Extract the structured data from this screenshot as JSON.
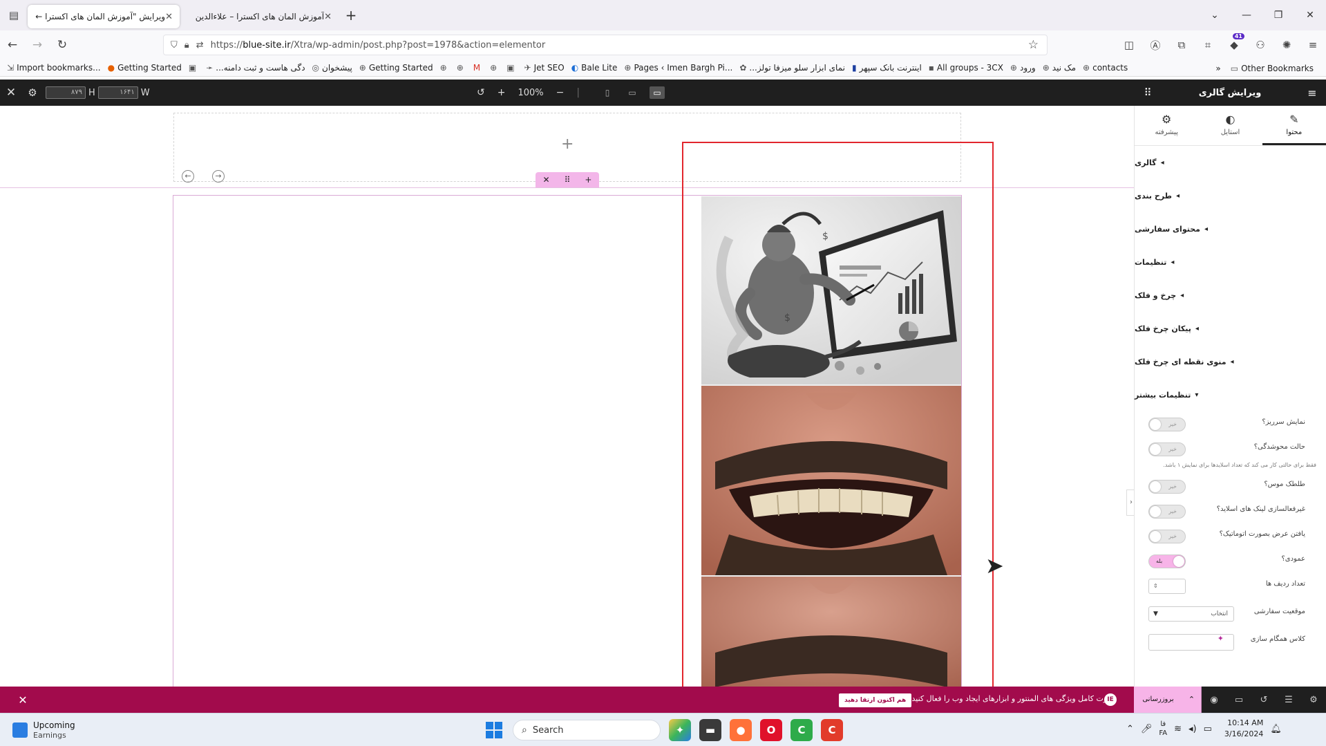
{
  "browser": {
    "tabs": [
      {
        "label": "ویرایش \"آموزش المان های اکسترا ←",
        "active": true
      },
      {
        "label": "آموزش المان های اکسترا – علاءالدین",
        "active": false
      }
    ],
    "url_prefix": "https://",
    "url_domain": "blue-site.ir",
    "url_path": "/Xtra/wp-admin/post.php?post=1978&action=elementor",
    "extension_badge": "41"
  },
  "bookmarks": [
    "Import bookmarks...",
    "Getting Started",
    "...دگی هاست و ثبت دامنه",
    "پیشخوان",
    "Getting Started",
    "Jet SEO",
    "Bale Lite",
    "Pages ‹ Imen Bargh Pi...",
    "...نمای ابزار سلو میزفا تولز",
    "اینترنت بانک سپهر",
    "All groups - 3CX",
    "ورود",
    "مک نید",
    "contacts"
  ],
  "bookmarks_other": "Other Bookmarks",
  "editor": {
    "height_value": "۸۷۹",
    "height_label": "H",
    "width_value": "۱۶۴۱",
    "width_label": "W",
    "zoom": "100%",
    "panel_title": "ویرایش گالری",
    "panel_tabs": [
      {
        "label": "محتوا",
        "icon": "pencil-icon"
      },
      {
        "label": "استایل",
        "icon": "contrast-icon"
      },
      {
        "label": "پیشرفته",
        "icon": "gear-icon"
      }
    ],
    "sections": [
      "گالری",
      "طرح بندی",
      "محتوای سفارشی",
      "تنظیمات",
      "چرخ و فلک",
      "پیکان چرخ فلک",
      "منوی نقطه ای چرخ فلک",
      "تنظیمات بیشتر"
    ],
    "controls": [
      {
        "label": "نمایش سرریز؟",
        "state": "خیر",
        "on": false
      },
      {
        "label": "حالت محوشدگی؟",
        "state": "خیر",
        "on": false
      }
    ],
    "fade_hint": "فقط برای حالتی کار می کند که تعداد اسلایدها برای نمایش ۱ باشد.",
    "controls2": [
      {
        "label": "طلطک موس؟",
        "state": "خیر",
        "on": false
      },
      {
        "label": "غیرفعالسازی لینک های اسلاید؟",
        "state": "خیر",
        "on": false
      },
      {
        "label": "یافتن عرض بصورت اتوماتیک؟",
        "state": "خیر",
        "on": false
      },
      {
        "label": "عمودی؟",
        "state": "بله",
        "on": true
      }
    ],
    "rows_label": "تعداد ردیف ها",
    "position_label": "موقعیت سفارشی",
    "position_value": "انتخاب",
    "sync_label": "کلاس همگام سازی",
    "promo_text": "قدرت کامل ویژگی های المنتور و ابزارهای ایجاد وب را فعال کنید.",
    "promo_cta": "هم اکنون ارتقا دهید",
    "publish_label": "بروزرسانی"
  },
  "taskbar": {
    "weather_title": "Upcoming",
    "weather_sub": "Earnings",
    "search_placeholder": "Search",
    "lang_top": "فا",
    "lang_bottom": "FA",
    "time": "10:14 AM",
    "date": "3/16/2024"
  },
  "colors": {
    "accent_pink": "#f7b4e8",
    "promo_bg": "#a20b4c",
    "selection_red": "#e2262d",
    "editor_dark": "#1f1f1f"
  }
}
